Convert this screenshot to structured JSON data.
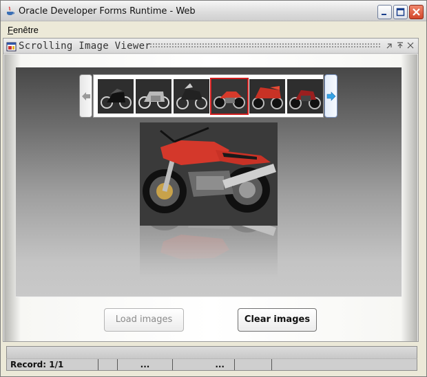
{
  "window": {
    "title": "Oracle Developer Forms Runtime - Web",
    "controls": [
      "minimize-icon",
      "maximize-icon",
      "close-icon"
    ]
  },
  "menubar": {
    "items": [
      {
        "label": "Fenêtre",
        "mnemonic": "F"
      }
    ]
  },
  "inner_window": {
    "title": "Scrolling Image Viewer",
    "controls": [
      "restore-icon",
      "maximize-icon",
      "close-icon"
    ]
  },
  "viewer": {
    "thumbnails": [
      {
        "subject": "black motorcycle",
        "selected": false
      },
      {
        "subject": "silver motorcycle",
        "selected": false
      },
      {
        "subject": "black touring motorcycle",
        "selected": false
      },
      {
        "subject": "red motorcycle",
        "selected": true
      },
      {
        "subject": "red sport motorcycle",
        "selected": false
      },
      {
        "subject": "red-black motorcycle",
        "selected": false
      }
    ],
    "main_image": "red motorcycle"
  },
  "buttons": {
    "load": "Load images",
    "clear": "Clear images"
  },
  "status": {
    "record": "Record: 1/1",
    "seg3": "...",
    "seg5": "..."
  },
  "colors": {
    "selection": "#d11c1c",
    "panel_top": "#474747",
    "panel_bottom": "#c9c9c9"
  }
}
